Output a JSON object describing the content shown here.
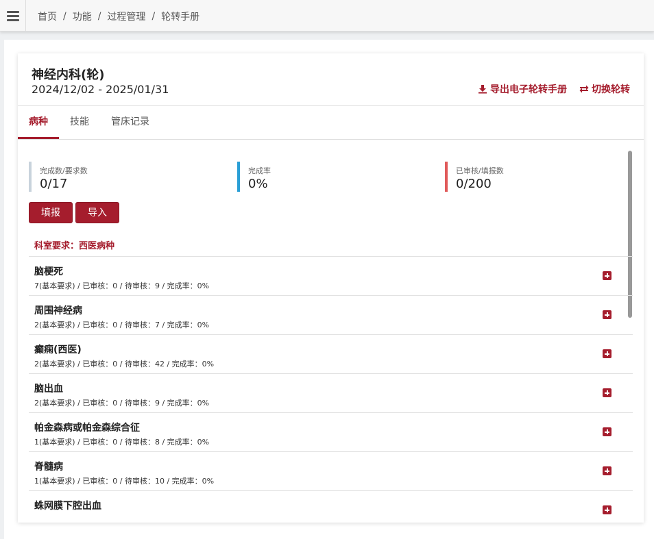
{
  "breadcrumb": [
    "首页",
    "功能",
    "过程管理",
    "轮转手册"
  ],
  "header": {
    "dept_title": "神经内科(轮)",
    "date_range": "2024/12/02 - 2025/01/31",
    "export_label": "导出电子轮转手册",
    "switch_label": "切换轮转"
  },
  "tabs": [
    {
      "label": "病种",
      "active": true
    },
    {
      "label": "技能",
      "active": false
    },
    {
      "label": "管床记录",
      "active": false
    }
  ],
  "stats": [
    {
      "label": "完成数/要求数",
      "value": "0/17",
      "color": "#c8d3dc"
    },
    {
      "label": "完成率",
      "value": "0%",
      "color": "#2a9fd6"
    },
    {
      "label": "已审核/填报数",
      "value": "0/200",
      "color": "#e05a5a"
    }
  ],
  "buttons": {
    "fill": "填报",
    "import": "导入"
  },
  "requirement_title": "科室要求：西医病种",
  "diseases": [
    {
      "name": "脑梗死",
      "meta": "7(基本要求) / 已审核：0 / 待审核：9 / 完成率：0%"
    },
    {
      "name": "周围神经病",
      "meta": "2(基本要求) / 已审核：0 / 待审核：7 / 完成率：0%"
    },
    {
      "name": "癫痫(西医)",
      "meta": "2(基本要求) / 已审核：0 / 待审核：42 / 完成率：0%"
    },
    {
      "name": "脑出血",
      "meta": "2(基本要求) / 已审核：0 / 待审核：9 / 完成率：0%"
    },
    {
      "name": "帕金森病或帕金森综合征",
      "meta": "1(基本要求) / 已审核：0 / 待审核：8 / 完成率：0%"
    },
    {
      "name": "脊髓病",
      "meta": "1(基本要求) / 已审核：0 / 待审核：10 / 完成率：0%"
    },
    {
      "name": "蛛网膜下腔出血",
      "meta": ""
    }
  ],
  "colors": {
    "accent": "#a51d2d"
  }
}
